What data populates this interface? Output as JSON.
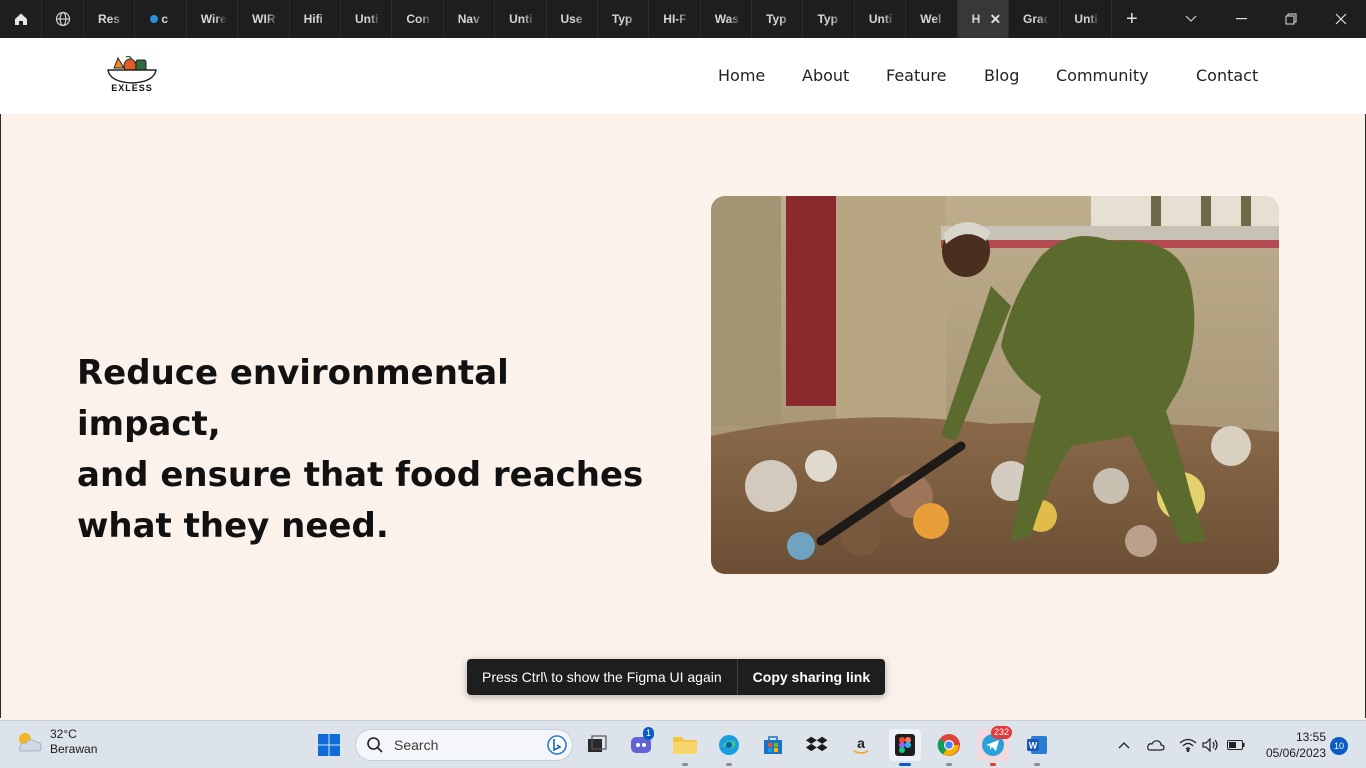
{
  "figma": {
    "tabs": [
      "Res",
      "c",
      "Wire",
      "WIR",
      "Hifi",
      "Unti",
      "Con",
      "Nav",
      "Unti",
      "Use",
      "Typ",
      "HI-F",
      "Was",
      "Typ",
      "Typ",
      "Unti",
      "Wel",
      "H",
      "Grad",
      "Unti"
    ],
    "active_tab_index": 17,
    "icons": [
      "home-icon",
      "globe-icon",
      "plus-icon",
      "chevron-down-icon",
      "minimize-icon",
      "restore-icon",
      "close-icon"
    ]
  },
  "site": {
    "logo_text": "EXLESS",
    "nav": [
      "Home",
      "About",
      "Feature",
      "Blog",
      "Community",
      "Contact"
    ]
  },
  "hero": {
    "title_lines": [
      "Reduce environmental impact,",
      "and ensure that food reaches",
      "what they need."
    ],
    "image_icon": "photo-man-collecting-waste"
  },
  "toast": {
    "message": "Press Ctrl\\ to show the Figma UI again",
    "action": "Copy sharing link"
  },
  "taskbar": {
    "weather_temp": "32°C",
    "weather_desc": "Berawan",
    "search_placeholder": "Search",
    "teams_badge": "1",
    "telegram_badge": "232",
    "time": "13:55",
    "date": "05/06/2023",
    "notification_count": "10",
    "colors": {
      "accent": "#0a5cc2",
      "telegram": "#2aa1da",
      "figma_active": "#4fc3f7"
    }
  }
}
